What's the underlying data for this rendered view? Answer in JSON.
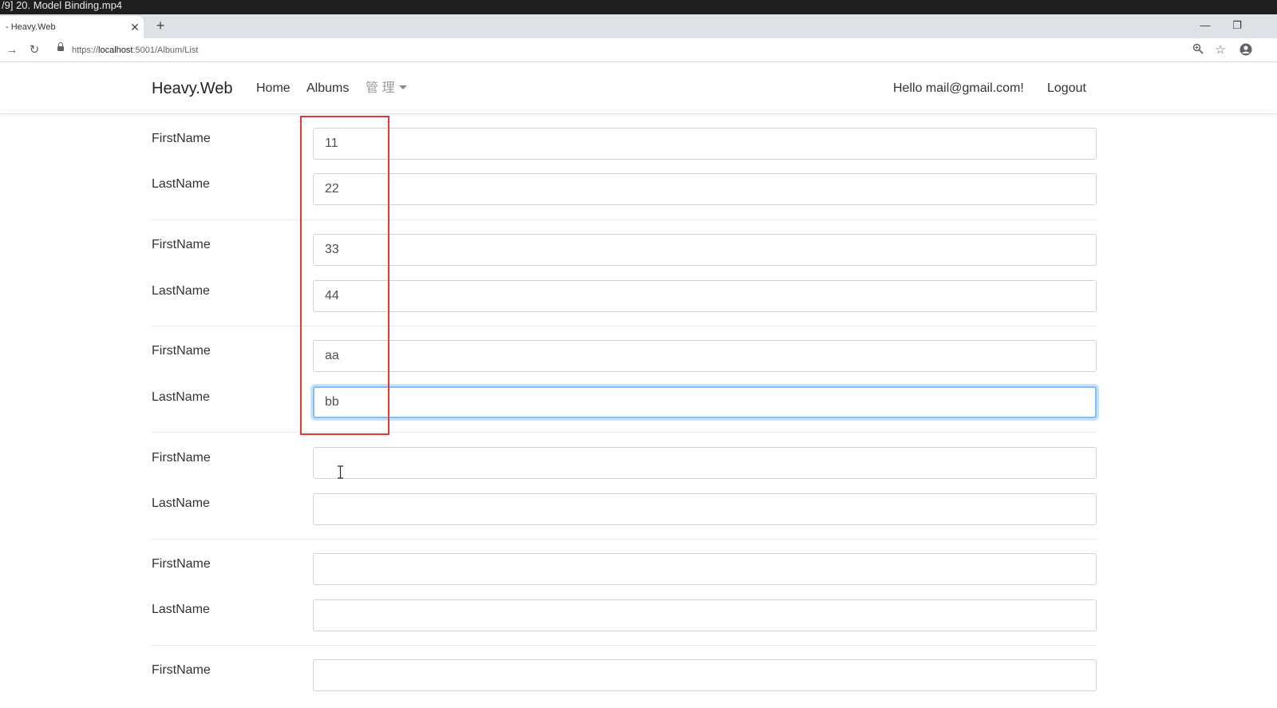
{
  "player": {
    "title": "/9] 20. Model Binding.mp4"
  },
  "browser": {
    "tab_title": "- Heavy.Web",
    "url_scheme": "https://",
    "url_host": "localhost",
    "url_rest": ":5001/Album/List"
  },
  "navbar": {
    "brand": "Heavy.Web",
    "links": [
      "Home",
      "Albums"
    ],
    "admin": "管 理",
    "greeting": "Hello mail@gmail.com!",
    "logout": "Logout"
  },
  "form": {
    "first_label": "FirstName",
    "last_label": "LastName",
    "people": [
      {
        "first": "11",
        "last": "22"
      },
      {
        "first": "33",
        "last": "44"
      },
      {
        "first": "aa",
        "last": "bb"
      },
      {
        "first": "",
        "last": ""
      },
      {
        "first": "",
        "last": ""
      },
      {
        "first": ""
      }
    ]
  },
  "colors": {
    "highlight": "#e53935",
    "focus": "#80bdff"
  }
}
